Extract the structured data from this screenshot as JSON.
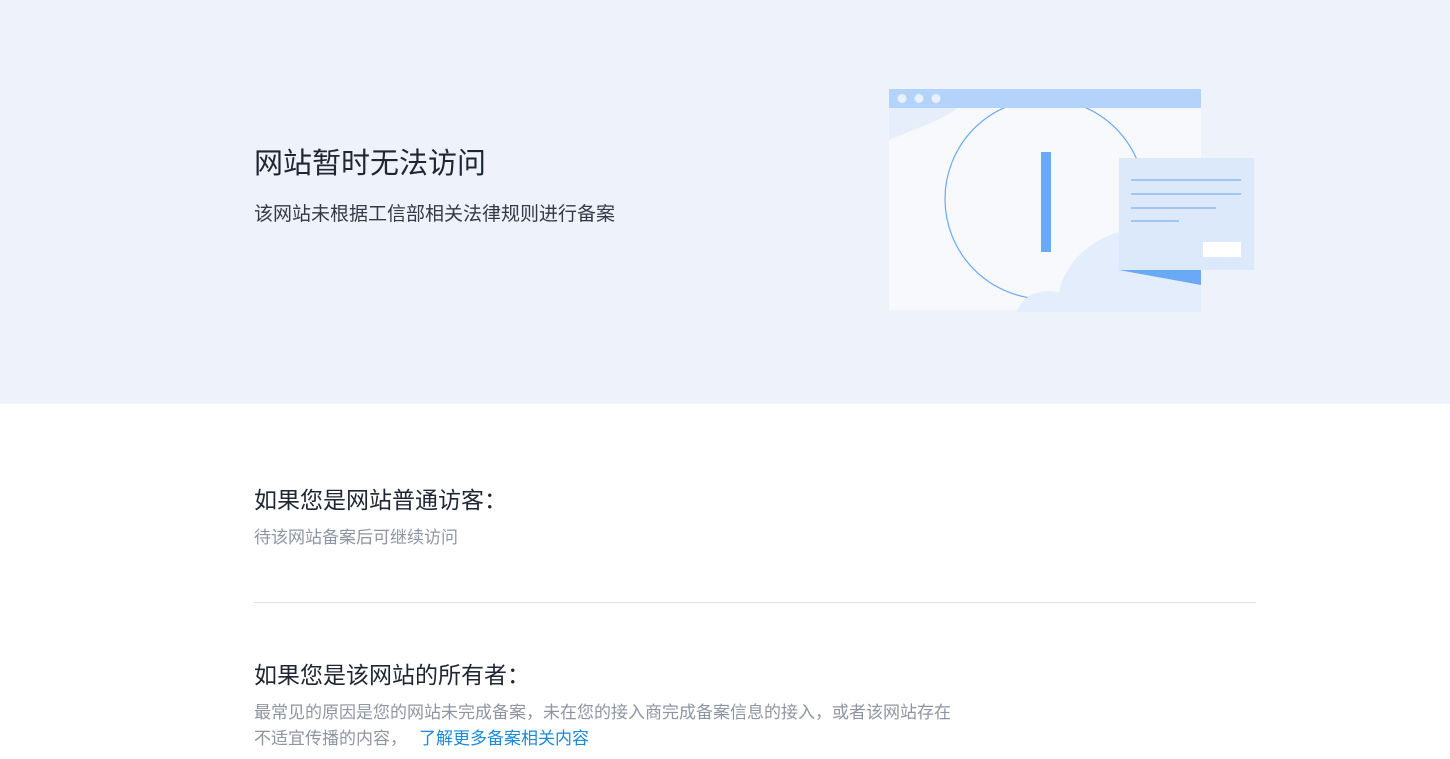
{
  "hero": {
    "title": "网站暂时无法访问",
    "subtitle": "该网站未根据工信部相关法律规则进行备案"
  },
  "visitor": {
    "title": "如果您是网站普通访客：",
    "text": "待该网站备案后可继续访问"
  },
  "owner": {
    "title": "如果您是该网站的所有者：",
    "text_line1": "最常见的原因是您的网站未完成备案，未在您的接入商完成备案信息的接入，或者该网站存在",
    "text_line2": "不适宜传播的内容，",
    "link_label": "了解更多备案相关内容"
  },
  "illustration": {
    "icon": "warning-browser-illustration"
  },
  "colors": {
    "hero_background": "#eef3fb",
    "link": "#1a8ad9",
    "accent_blue": "#6aa9f5"
  }
}
